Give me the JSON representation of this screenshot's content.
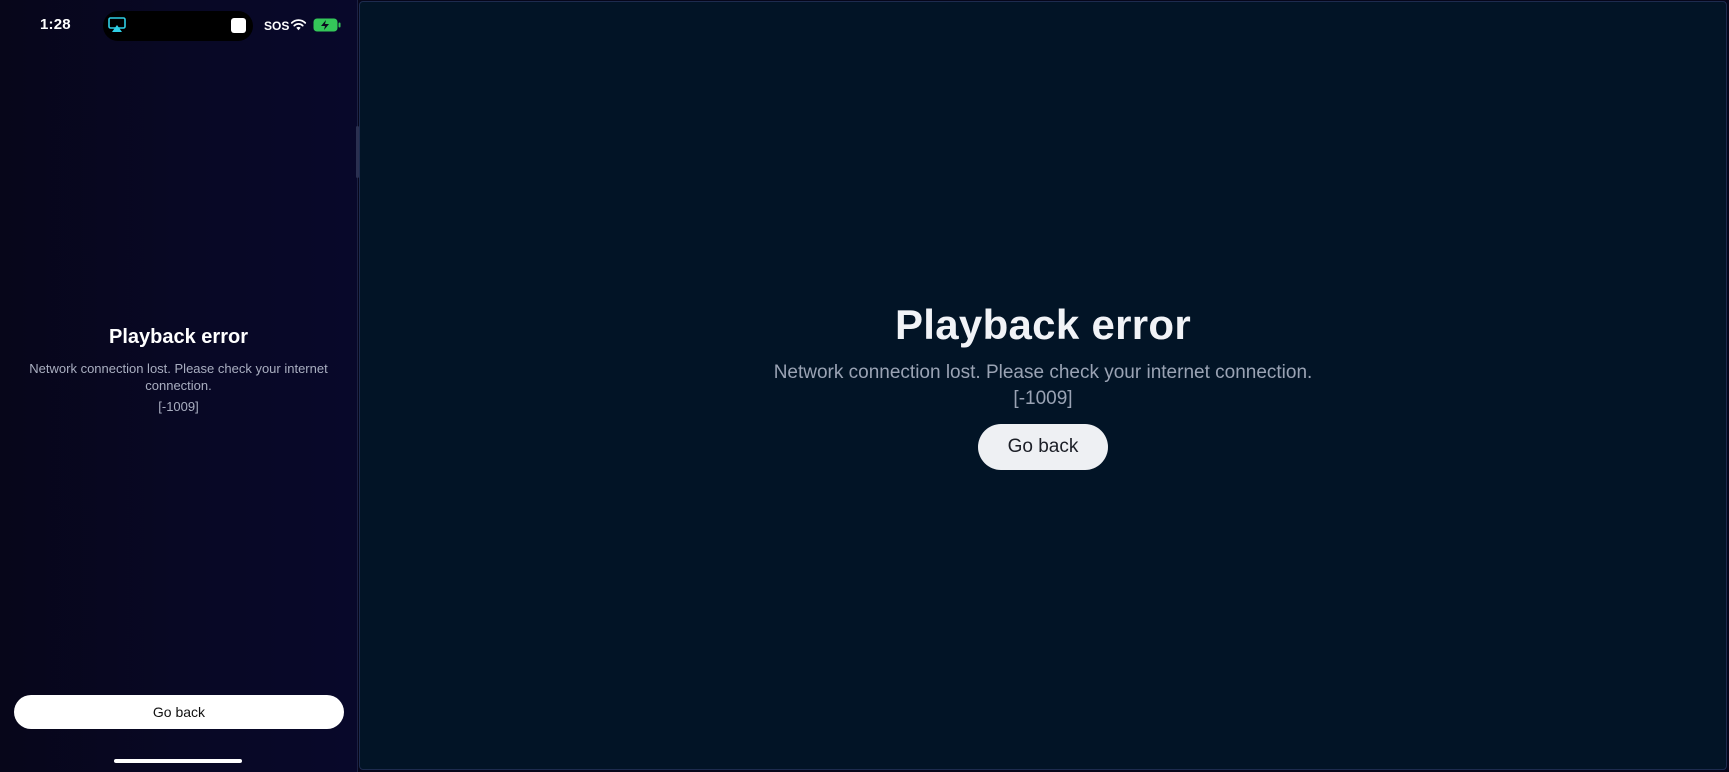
{
  "status_bar": {
    "time": "1:28",
    "sos": "SOS",
    "icons": [
      "airplay-icon",
      "tv-badge-icon",
      "wifi-icon",
      "battery-charging-icon"
    ],
    "battery_color": "#34c759",
    "airplay_color": "#2fd0e6"
  },
  "phone": {
    "title": "Playback error",
    "message": "Network connection lost. Please check your internet connection.",
    "code": "[-1009]",
    "go_back_label": "Go back"
  },
  "external_display": {
    "title": "Playback error",
    "message": "Network connection lost. Please check your internet connection.",
    "code": "[-1009]",
    "go_back_label": "Go back",
    "background_color": "#021426"
  }
}
